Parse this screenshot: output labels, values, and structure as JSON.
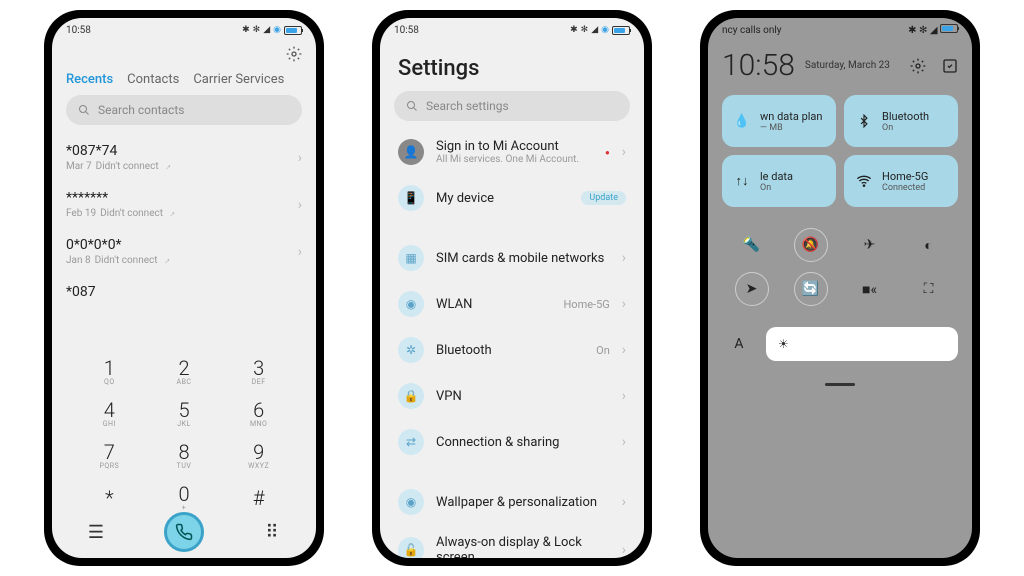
{
  "status": {
    "time": "10:58"
  },
  "dialer": {
    "tabs": [
      "Recents",
      "Contacts",
      "Carrier Services"
    ],
    "search_placeholder": "Search contacts",
    "calls": [
      {
        "number": "*087*74",
        "date": "Mar 7",
        "status": "Didn't connect"
      },
      {
        "number": "*******",
        "date": "Feb 19",
        "status": "Didn't connect"
      },
      {
        "number": "0*0*0*0*",
        "date": "Jan 8",
        "status": "Didn't connect"
      },
      {
        "number": "*087",
        "date": "",
        "status": ""
      }
    ],
    "keys": [
      {
        "d": "1",
        "l": "QO"
      },
      {
        "d": "2",
        "l": "ABC"
      },
      {
        "d": "3",
        "l": "DEF"
      },
      {
        "d": "4",
        "l": "GHI"
      },
      {
        "d": "5",
        "l": "JKL"
      },
      {
        "d": "6",
        "l": "MNO"
      },
      {
        "d": "7",
        "l": "PQRS"
      },
      {
        "d": "8",
        "l": "TUV"
      },
      {
        "d": "9",
        "l": "WXYZ"
      },
      {
        "d": "*",
        "l": ""
      },
      {
        "d": "0",
        "l": "+"
      },
      {
        "d": "#",
        "l": ""
      }
    ]
  },
  "settings": {
    "title": "Settings",
    "search_placeholder": "Search settings",
    "account": {
      "title": "Sign in to Mi Account",
      "sub": "All Mi services. One Mi Account."
    },
    "device": {
      "title": "My device",
      "badge": "Update"
    },
    "items": [
      {
        "title": "SIM cards & mobile networks",
        "value": ""
      },
      {
        "title": "WLAN",
        "value": "Home-5G"
      },
      {
        "title": "Bluetooth",
        "value": "On"
      },
      {
        "title": "VPN",
        "value": ""
      },
      {
        "title": "Connection & sharing",
        "value": ""
      }
    ],
    "items2": [
      {
        "title": "Wallpaper & personalization"
      },
      {
        "title": "Always-on display & Lock screen"
      }
    ]
  },
  "cc": {
    "carrier": "ncy calls only",
    "time": "10:58",
    "date": "Saturday, March 23",
    "tiles": [
      {
        "title": "wn data plan",
        "sub": "— MB",
        "icon": "💧"
      },
      {
        "title": "Bluetooth",
        "sub": "On",
        "icon": "bt"
      },
      {
        "title": "le data",
        "sub": "On",
        "icon": "data"
      },
      {
        "title": "Home-5G",
        "sub": "Connected",
        "icon": "wifi"
      }
    ],
    "toggles_row1": [
      "flashlight",
      "mute",
      "airplane",
      "dark"
    ],
    "toggles_row2": [
      "location",
      "rotate",
      "video",
      "scan"
    ]
  }
}
